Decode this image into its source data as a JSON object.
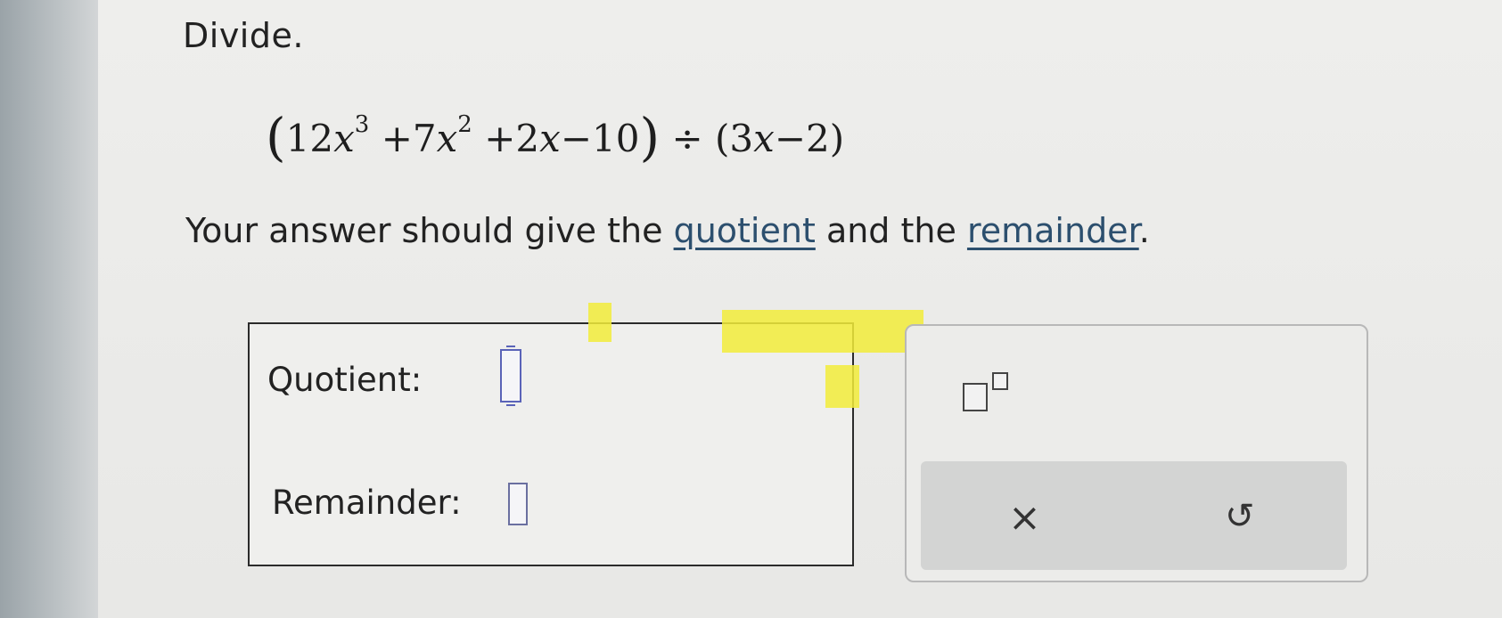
{
  "problem": {
    "title": "Divide.",
    "expression": {
      "open_paren": "(",
      "dividend_part1": "12",
      "var1": "x",
      "exp1": "3",
      "dividend_part2": "+7",
      "var2": "x",
      "exp2": "2",
      "dividend_part3": "+2",
      "var3": "x",
      "dividend_part4": "−10",
      "close_paren": ")",
      "divide_sign": "÷",
      "divisor_open": "(3",
      "divisor_var": "x",
      "divisor_rest": "−2)"
    },
    "instruction_prefix": "Your answer should give the ",
    "quotient_link": "quotient",
    "instruction_mid": " and the ",
    "remainder_link": "remainder",
    "instruction_suffix": "."
  },
  "answer": {
    "quotient_label": "Quotient:",
    "remainder_label": "Remainder:"
  },
  "tools": {
    "exponent_icon": "superscript-template-icon",
    "clear_label": "×",
    "undo_label": "↺"
  },
  "colors": {
    "highlight": "#f2ec3a",
    "input_border": "#5a63b8",
    "link": "#2c4f6e"
  }
}
